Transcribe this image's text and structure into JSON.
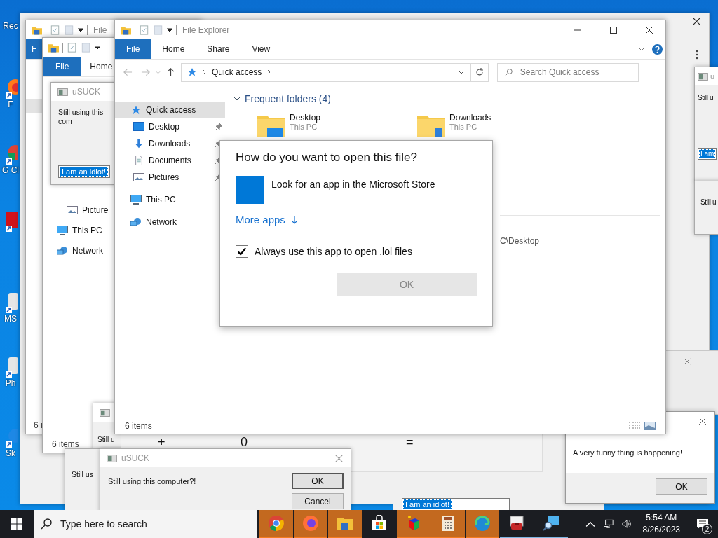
{
  "desktop_icons": [
    {
      "kind": "recycle",
      "label": "Rec"
    },
    {
      "kind": "firefox",
      "label": "F"
    },
    {
      "kind": "chrome",
      "label": "G Cl"
    },
    {
      "kind": "red-app"
    },
    {
      "kind": "generic",
      "label": "MS"
    },
    {
      "kind": "generic",
      "label": "Ph"
    },
    {
      "kind": "skype",
      "label": "Sk"
    }
  ],
  "explorer_back": {
    "title": "File",
    "tabs": [
      {
        "label": "F",
        "selected": true
      }
    ],
    "status": "6 i"
  },
  "explorer_middle": {
    "tabs": [
      {
        "label": "File",
        "selected": true
      },
      {
        "label": "Home",
        "selected": false
      }
    ],
    "nav": [
      {
        "label": "Picture",
        "kind": "pictures"
      },
      {
        "label": "This PC",
        "kind": "pc"
      },
      {
        "label": "Network",
        "kind": "network"
      }
    ],
    "status": "6 items"
  },
  "usuck_small": {
    "title": "uSUCK",
    "message": "Still using this com",
    "input": "I am an idiot!"
  },
  "explorer": {
    "title": "File Explorer",
    "tabs": [
      {
        "label": "File",
        "selected": true
      },
      {
        "label": "Home",
        "selected": false
      },
      {
        "label": "Share",
        "selected": false
      },
      {
        "label": "View",
        "selected": false
      }
    ],
    "address": "Quick access",
    "search_placeholder": "Search Quick access",
    "nav": [
      {
        "label": "Quick access",
        "kind": "quick",
        "selected": true,
        "children": [
          {
            "label": "Desktop",
            "kind": "desktop",
            "selected": false,
            "pinned": true
          },
          {
            "label": "Downloads",
            "kind": "downloads",
            "selected": false,
            "pinned": true
          },
          {
            "label": "Documents",
            "kind": "documents",
            "selected": false,
            "pinned": true
          },
          {
            "label": "Pictures",
            "kind": "pictures",
            "selected": false,
            "pinned": true
          }
        ]
      },
      {
        "label": "This PC",
        "kind": "pc",
        "selected": false
      },
      {
        "label": "Network",
        "kind": "network",
        "selected": false
      }
    ],
    "section": "Frequent folders (4)",
    "folders": [
      {
        "name": "Desktop",
        "location": "This PC",
        "kind": "desktop"
      },
      {
        "name": "Downloads",
        "location": "This PC",
        "kind": "downloads"
      }
    ],
    "path_fragment": "C\\Desktop",
    "status": "6 items"
  },
  "open_with": {
    "title": "How do you want to open this file?",
    "option": "Look for an app in the Microsoft Store",
    "more": "More apps",
    "always": {
      "label": "Always use this app to open .lol files",
      "checked": true
    },
    "ok": {
      "label": "OK",
      "disabled": true
    }
  },
  "right_dialogs": [
    {
      "title": "u",
      "message": "Still u",
      "input": "I am"
    },
    {
      "message": "Still u"
    }
  ],
  "back_dialogs": [
    {
      "message": "Still u"
    },
    {
      "message": "Still us"
    }
  ],
  "calculator_keys": [
    "+",
    "0",
    "="
  ],
  "usuck": {
    "title": "uSUCK",
    "message": "Still using this computer?!",
    "buttons": [
      {
        "label": "OK",
        "default": true
      },
      {
        "label": "Cancel",
        "default": false
      }
    ]
  },
  "message_box": {
    "message": "A very funny thing is happening!",
    "button": "OK"
  },
  "stray_input": "I am an idiot!",
  "taskbar": {
    "search_placeholder": "Type here to search",
    "apps": [
      {
        "kind": "chrome",
        "flashing": true,
        "running": true
      },
      {
        "kind": "firefox",
        "flashing": true,
        "running": true
      },
      {
        "kind": "folder",
        "flashing": true,
        "running": true
      },
      {
        "kind": "store",
        "flashing": false,
        "running": false
      },
      {
        "kind": "cube",
        "flashing": true,
        "running": true
      },
      {
        "kind": "calculator",
        "flashing": true,
        "running": true
      },
      {
        "kind": "edge",
        "flashing": true,
        "running": true
      },
      {
        "kind": "toolbox",
        "flashing": false,
        "running": true
      },
      {
        "kind": "magnifier",
        "flashing": false,
        "running": true
      }
    ],
    "time": "5:54 AM",
    "date": "8/26/2023",
    "notifications": "2"
  }
}
